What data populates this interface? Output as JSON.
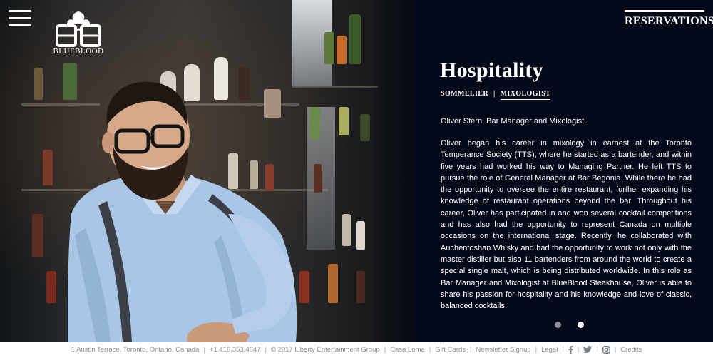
{
  "header": {
    "menu_icon": "hamburger-menu-icon",
    "logo_text": "BLUEBLOOD",
    "reservations_label": "RESERVATIONS"
  },
  "panel": {
    "title": "Hospitality",
    "tabs": [
      {
        "label": "SOMMELIER",
        "active": false
      },
      {
        "label": "MIXOLOGIST",
        "active": true
      }
    ],
    "tab_separator": "|",
    "person_name": "Oliver Stern, Bar Manager and Mixologist",
    "bio": "Oliver began his career in mixology in earnest at the Toronto Temperance Society (TTS), where he started as a bartender, and within five years had worked his way to Managing Partner. He left TTS to pursue the role of General Manager at Bar Begonia. While there he had the opportunity to oversee the entire restaurant, further expanding his knowledge of restaurant operations beyond the bar. Throughout his career, Oliver has participated in and won several cocktail competitions and has also had the opportunity to represent Canada on multiple occasions on the international stage. Recently, he collaborated with Auchentoshan Whisky and had the opportunity to work not only with the master distiller but also 11 bartenders from around the world to create a special single malt, which is being distributed worldwide. In this role as Bar Manager and Mixologist at BlueBlood Steakhouse, Oliver is able to share his passion for hospitality and his knowledge and love of classic, balanced cocktails.",
    "carousel": {
      "count": 2,
      "active_index": 1
    }
  },
  "footer": {
    "items": [
      "1 Austin Terrace, Toronto, Ontario, Canada",
      "+1.416.353.4647",
      "© 2017 Liberty Entertainment Group",
      "Casa Loma",
      "Gift Cards",
      "Newsletter Signup",
      "Legal"
    ],
    "social_icons": [
      "facebook-icon",
      "twitter-icon",
      "instagram-icon"
    ],
    "credits": "Credits"
  },
  "colors": {
    "panel_bg": "#050a1a",
    "footer_text": "#8b8f96",
    "dot_inactive": "#8a8d93",
    "dot_active": "#ffffff"
  }
}
